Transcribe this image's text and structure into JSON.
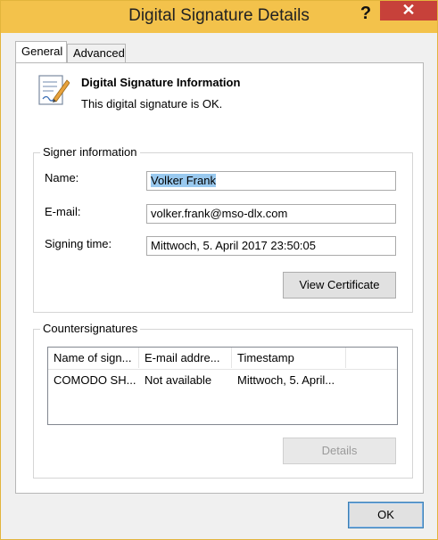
{
  "window": {
    "title": "Digital Signature Details",
    "help_label": "?",
    "close_label": "✕"
  },
  "tabs": [
    {
      "label": "General",
      "active": true
    },
    {
      "label": "Advanced",
      "active": false
    }
  ],
  "signature": {
    "heading": "Digital Signature Information",
    "status": "This digital signature is OK.",
    "icon": "certificate-pen-icon"
  },
  "signer": {
    "group_title": "Signer information",
    "name_label": "Name:",
    "name_value": "Volker Frank",
    "email_label": "E-mail:",
    "email_value": "volker.frank@mso-dlx.com",
    "time_label": "Signing time:",
    "time_value": "Mittwoch, 5. April 2017 23:50:05",
    "view_cert_label": "View Certificate"
  },
  "countersignatures": {
    "group_title": "Countersignatures",
    "columns": [
      "Name of sign...",
      "E-mail addre...",
      "Timestamp"
    ],
    "rows": [
      {
        "name": "COMODO SH...",
        "email": "Not available",
        "timestamp": "Mittwoch, 5. April..."
      }
    ],
    "details_label": "Details"
  },
  "footer": {
    "ok_label": "OK"
  },
  "colors": {
    "titlebar": "#f3c24b",
    "close": "#c7413a",
    "selection": "#99c9ef"
  }
}
